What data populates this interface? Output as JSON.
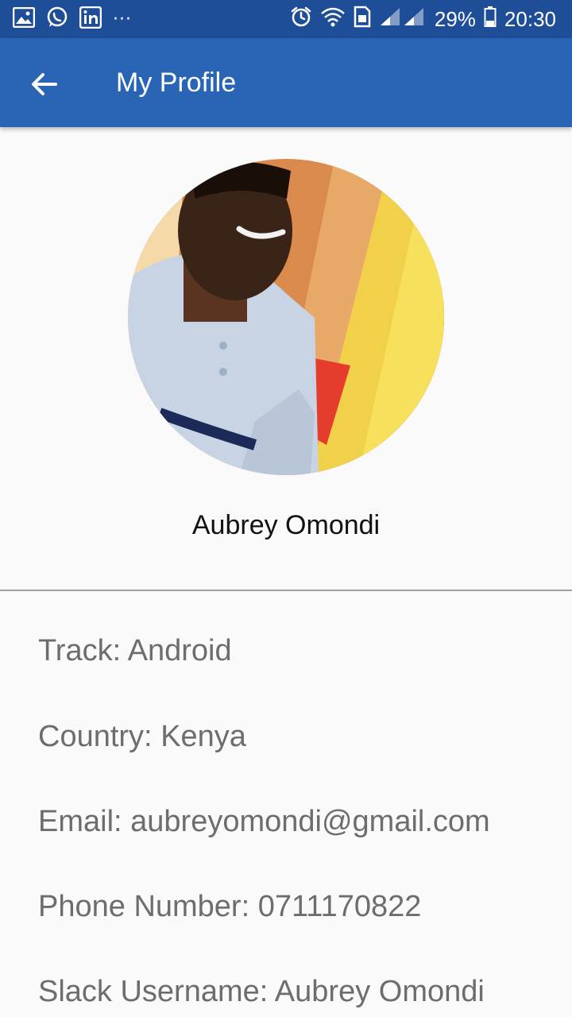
{
  "status_bar": {
    "battery": "29%",
    "time": "20:30",
    "overflow": "···",
    "icons": [
      "image-icon",
      "whatsapp-icon",
      "linkedin-icon",
      "alarm-icon",
      "wifi-icon",
      "sim-icon",
      "signal-icon",
      "battery-icon"
    ]
  },
  "app_bar": {
    "title": "My Profile",
    "back_icon": "arrow-back-icon"
  },
  "profile": {
    "name": "Aubrey Omondi"
  },
  "details": [
    {
      "label": "Track:",
      "value": "Android"
    },
    {
      "label": "Country:",
      "value": "Kenya"
    },
    {
      "label": "Email:",
      "value": "aubreyomondi@gmail.com"
    },
    {
      "label": "Phone Number:",
      "value": "0711170822"
    },
    {
      "label": "Slack Username:",
      "value": "Aubrey Omondi"
    }
  ],
  "colors": {
    "status_bar": "#1f4e98",
    "app_bar": "#2a64b4",
    "background": "#fafafa",
    "detail_text": "#6d6d6d"
  }
}
